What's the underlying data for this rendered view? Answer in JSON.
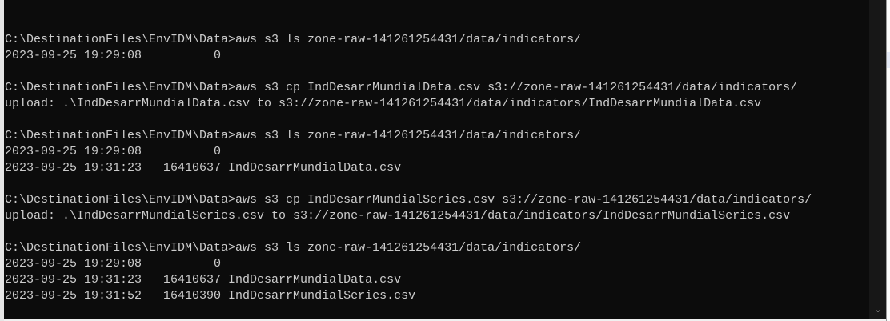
{
  "terminal": {
    "lines": [
      "",
      "C:\\DestinationFiles\\EnvIDM\\Data>aws s3 ls zone-raw-141261254431/data/indicators/",
      "2023-09-25 19:29:08          0",
      "",
      "C:\\DestinationFiles\\EnvIDM\\Data>aws s3 cp IndDesarrMundialData.csv s3://zone-raw-141261254431/data/indicators/",
      "upload: .\\IndDesarrMundialData.csv to s3://zone-raw-141261254431/data/indicators/IndDesarrMundialData.csv",
      "",
      "C:\\DestinationFiles\\EnvIDM\\Data>aws s3 ls zone-raw-141261254431/data/indicators/",
      "2023-09-25 19:29:08          0",
      "2023-09-25 19:31:23   16410637 IndDesarrMundialData.csv",
      "",
      "C:\\DestinationFiles\\EnvIDM\\Data>aws s3 cp IndDesarrMundialSeries.csv s3://zone-raw-141261254431/data/indicators/",
      "upload: .\\IndDesarrMundialSeries.csv to s3://zone-raw-141261254431/data/indicators/IndDesarrMundialSeries.csv",
      "",
      "C:\\DestinationFiles\\EnvIDM\\Data>aws s3 ls zone-raw-141261254431/data/indicators/",
      "2023-09-25 19:29:08          0",
      "2023-09-25 19:31:23   16410637 IndDesarrMundialData.csv",
      "2023-09-25 19:31:52   16410390 IndDesarrMundialSeries.csv",
      ""
    ],
    "prompt": "C:\\DestinationFiles\\EnvIDM\\Data>",
    "colors": {
      "background": "#0c0c0c",
      "text": "#cccccc"
    }
  },
  "scrollbar": {
    "down_icon": "chevron-down-icon",
    "glyph": "⌄"
  }
}
